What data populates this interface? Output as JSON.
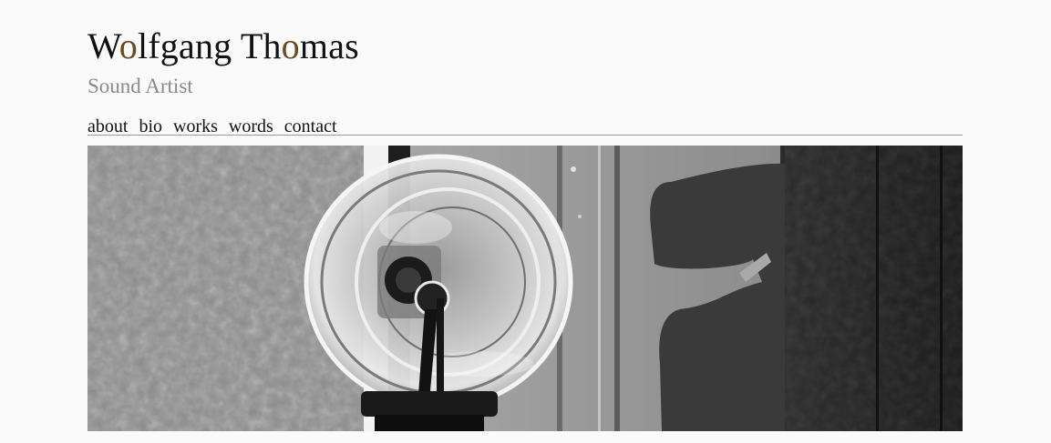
{
  "header": {
    "title_parts": [
      "W",
      "o",
      "lfgang Th",
      "o",
      "mas"
    ],
    "subtitle": "Sound Artist"
  },
  "nav": {
    "items": [
      {
        "label": "about"
      },
      {
        "label": "bio"
      },
      {
        "label": "works"
      },
      {
        "label": "words"
      },
      {
        "label": "contact"
      }
    ]
  },
  "colors": {
    "background": "#fafafa",
    "title": "#111111",
    "title_accent": "#6b4a22",
    "subtitle": "#8a8a8a",
    "rule": "#9a9a9a"
  },
  "hero": {
    "icon": "hero-photo-glass-bowl-microphone"
  }
}
